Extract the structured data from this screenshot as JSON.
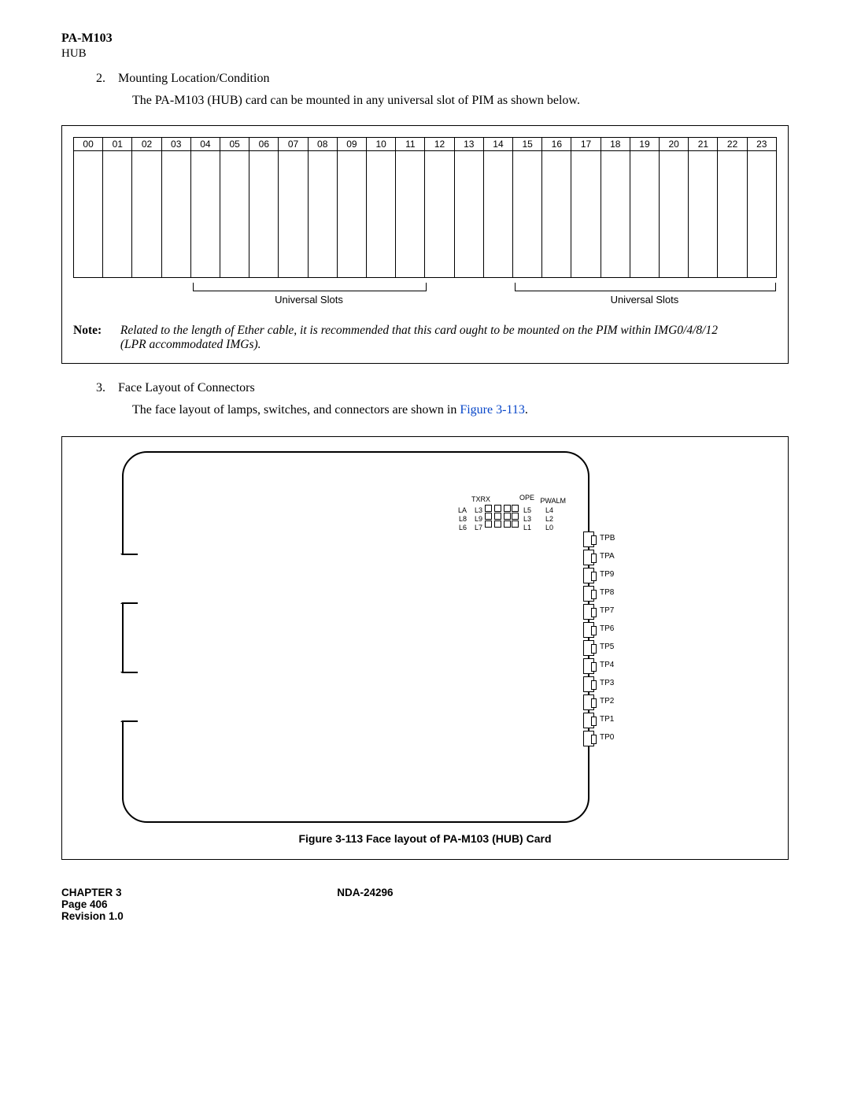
{
  "header": {
    "title": "PA-M103",
    "sub": "HUB"
  },
  "section2": {
    "num": "2.",
    "title": "Mounting Location/Condition",
    "body": "The PA-M103 (HUB) card can be mounted in any universal slot of PIM as shown below."
  },
  "slots": [
    "00",
    "01",
    "02",
    "03",
    "04",
    "05",
    "06",
    "07",
    "08",
    "09",
    "10",
    "11",
    "12",
    "13",
    "14",
    "15",
    "16",
    "17",
    "18",
    "19",
    "20",
    "21",
    "22",
    "23"
  ],
  "bracket_label": "Universal Slots",
  "note": {
    "label": "Note:",
    "text": "Related to the length of Ether cable, it is recommended that this card ought to be mounted on the PIM within IMG0/4/8/12 (LPR accommodated IMGs)."
  },
  "section3": {
    "num": "3.",
    "title": "Face Layout of Connectors",
    "body_pre": "The face layout of lamps, switches, and connectors are shown in ",
    "fig_ref": "Figure 3-113",
    "body_post": "."
  },
  "face": {
    "txrx": "TXRX",
    "left_col": [
      "LA",
      "L8",
      "L6"
    ],
    "mid_col1": [
      "L3",
      "L9",
      "L7"
    ],
    "mid_col2": [
      "L5",
      "L3",
      "L1"
    ],
    "ope": "OPE",
    "pwalm": "PWALM",
    "right_col": [
      "L4",
      "L2",
      "L0"
    ],
    "ports": [
      "TPB",
      "TPA",
      "TP9",
      "TP8",
      "TP7",
      "TP6",
      "TP5",
      "TP4",
      "TP3",
      "TP2",
      "TP1",
      "TP0"
    ]
  },
  "figure_caption": "Figure 3-113   Face layout of PA-M103 (HUB) Card",
  "footer": {
    "chapter": "CHAPTER 3",
    "doc": "NDA-24296",
    "page": "Page 406",
    "rev": "Revision 1.0"
  }
}
